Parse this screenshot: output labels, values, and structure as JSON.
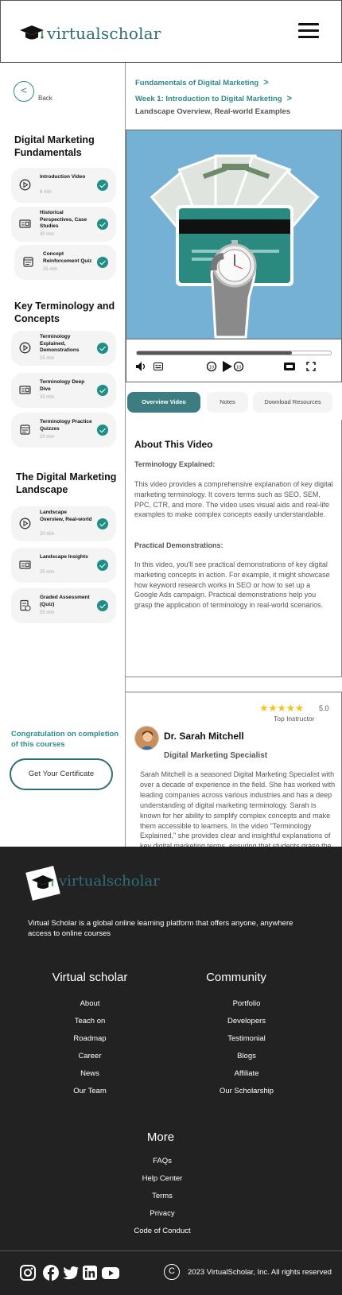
{
  "header": {
    "brand": "virtualscholar"
  },
  "sidebar": {
    "back_label": "Back",
    "back_glyph": "<",
    "sections": [
      {
        "title": "Digital Marketing Fundamentals",
        "lessons": [
          {
            "icon": "play-icon",
            "title": "Introduction Video",
            "duration": "6 min",
            "completed": true
          },
          {
            "icon": "reading-icon",
            "title": "Historical Perspectives, Case Studies",
            "duration": "30 min",
            "completed": true
          },
          {
            "icon": "quiz-icon",
            "title": "Concept Reinforcement Quiz",
            "duration": "25 min",
            "completed": true
          }
        ]
      },
      {
        "title": "Key Terminology and Concepts",
        "lessons": [
          {
            "icon": "play-icon",
            "title": "Terminology Explained, Demonstrations",
            "duration": "15 min",
            "completed": true
          },
          {
            "icon": "reading-icon",
            "title": "Terminology Deep Dive",
            "duration": "35 min",
            "completed": true
          },
          {
            "icon": "quiz-icon",
            "title": "Terminology Practice Quizzes",
            "duration": "20 min",
            "completed": true
          }
        ]
      },
      {
        "title": "The Digital Marketing Landscape",
        "lessons": [
          {
            "icon": "play-icon",
            "title": "Landscape Overview, Real-world",
            "duration": "20 min",
            "completed": true
          },
          {
            "icon": "reading-icon",
            "title": "Landscape Insights",
            "duration": "25 min",
            "completed": true
          },
          {
            "icon": "assessment-icon",
            "title": "Graded Assessment (Quiz)",
            "duration": "55 min",
            "completed": true
          }
        ]
      }
    ],
    "congrats": "Congratulation on completion of this courses",
    "certificate_button": "Get Your Certificate"
  },
  "breadcrumb": {
    "course": "Fundamentals of Digital Marketing",
    "week": "Week 1: Introduction to Digital Marketing",
    "current": "Landscape Overview, Real-world Examples",
    "separator": ">"
  },
  "player": {
    "progress_fraction": 0.8,
    "icons": [
      "volume-icon",
      "captions-icon",
      "rewind-10-icon",
      "play-icon",
      "forward-10-icon",
      "quality-icon",
      "fullscreen-icon"
    ]
  },
  "tabs": [
    "Overview Video",
    "Notes",
    "Download Resources"
  ],
  "about": {
    "heading": "About This Video",
    "sub1": "Terminology Explained:",
    "para1": "This video provides a comprehensive explanation of key digital marketing terminology. It covers terms such as SEO, SEM, PPC, CTR, and more. The video uses visual aids and real-life examples to make complex concepts easily understandable.",
    "sub2": "Practical Demonstrations:",
    "para2": "In this video, you'll see practical demonstrations of key digital marketing concepts in action. For example, it might showcase how keyword research works in SEO or how to set up a Google Ads campaign. Practical demonstrations help you grasp the application of terminology in real-world scenarios."
  },
  "instructor": {
    "stars": "★★★★★",
    "rating": "5.0",
    "badge": "Top Instructor",
    "name": "Dr. Sarah Mitchell",
    "role": "Digital Marketing Specialist",
    "bio": "Sarah Mitchell is a seasoned Digital Marketing Specialist with over a decade of experience in the field. She has worked with leading companies across various industries and has a deep understanding of digital marketing terminology. Sarah is known for her ability to simplify complex concepts and make them accessible to learners. In the video \"Terminology Explained,\" she provides clear and insightful explanations of key digital marketing terms, ensuring that students grasp the terminology essential for success in the digital marketing landscape."
  },
  "footer": {
    "brand": "virtualscholar",
    "description": "Virtual Scholar is a global online learning platform that offers anyone, anywhere access to online courses",
    "col1_title": "Virtual scholar",
    "col1_links": [
      "About",
      "Teach on",
      "Roadmap",
      "Career",
      "News",
      "Our Team"
    ],
    "col2_title": "Community",
    "col2_links": [
      "Portfolio",
      "Developers",
      "Testimonial",
      "Blogs",
      "Affiliate",
      "Our Scholarship"
    ],
    "col3_title": "More",
    "col3_links": [
      "FAQs",
      "Help Center",
      "Terms",
      "Privacy",
      "Code of Conduct"
    ],
    "social": [
      "instagram-icon",
      "facebook-icon",
      "twitter-icon",
      "linkedin-icon",
      "youtube-icon"
    ],
    "copyright_symbol": "C",
    "copyright": "2023 VirtualScholar, Inc. All rights reserved"
  },
  "colors": {
    "accent": "#2e8b8b",
    "check": "#1f8f86",
    "tab_active": "#3b7d80",
    "footer_bg": "#222222",
    "video_bg": "#75b1d4",
    "star": "#f5c518"
  }
}
